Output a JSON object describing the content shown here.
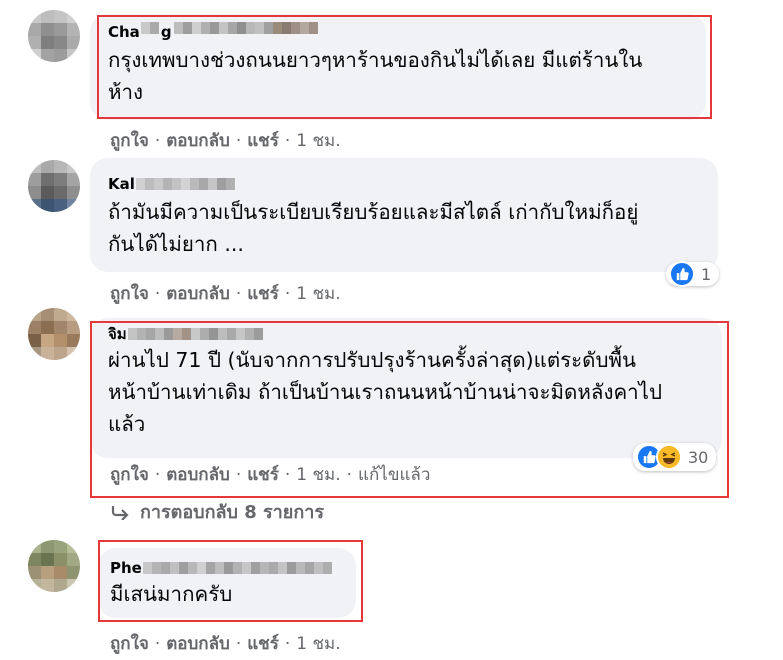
{
  "comments": [
    {
      "author_visible": "Cha",
      "author_tail": "g",
      "text_line1": "กรุงเทพบางช่วงถนนยาวๆหาร้านของกินไม่ได้เลย มีแต่ร้านใน",
      "text_line2": "ห้าง",
      "actions": {
        "like": "ถูกใจ",
        "reply": "ตอบกลับ",
        "share": "แชร์",
        "time": "1 ชม."
      }
    },
    {
      "author_visible": "Kal",
      "text_line1": "ถ้ามันมีความเป็นระเบียบเรียบร้อยและมีสไตล์ เก่ากับใหม่ก็อยู่",
      "text_line2": "กันได้ไม่ยาก ...",
      "actions": {
        "like": "ถูกใจ",
        "reply": "ตอบกลับ",
        "share": "แชร์",
        "time": "1 ชม."
      },
      "reaction_count": "1"
    },
    {
      "author_visible": "จิม",
      "text_line1": "ผ่านไป 71 ปี (นับจากการปรับปรุงร้านครั้งล่าสุด)แต่ระดับพื้น",
      "text_line2": "หน้าบ้านเท่าเดิม ถ้าเป็นบ้านเราถนนหน้าบ้านน่าจะมิดหลังคาไป",
      "text_line3": "แล้ว",
      "actions": {
        "like": "ถูกใจ",
        "reply": "ตอบกลับ",
        "share": "แชร์",
        "time": "1 ชม.",
        "edited": "แก้ไขแล้ว"
      },
      "reaction_count": "30"
    },
    {
      "author_visible": "Phe",
      "text_line1": "มีเสน่มากครับ",
      "actions": {
        "like": "ถูกใจ",
        "reply": "ตอบกลับ",
        "share": "แชร์",
        "time": "1 ชม."
      }
    }
  ],
  "replies_link": "การตอบกลับ 8 รายการ",
  "separator": "·",
  "icons": {
    "reply_arrow": "reply-arrow-icon",
    "like": "like-icon",
    "haha": "haha-icon"
  },
  "colors": {
    "bubble": "#f0f2f5",
    "highlight": "#e5383b",
    "like": "#1877f2",
    "haha": "#f7b928",
    "meta_text": "#65676b"
  }
}
